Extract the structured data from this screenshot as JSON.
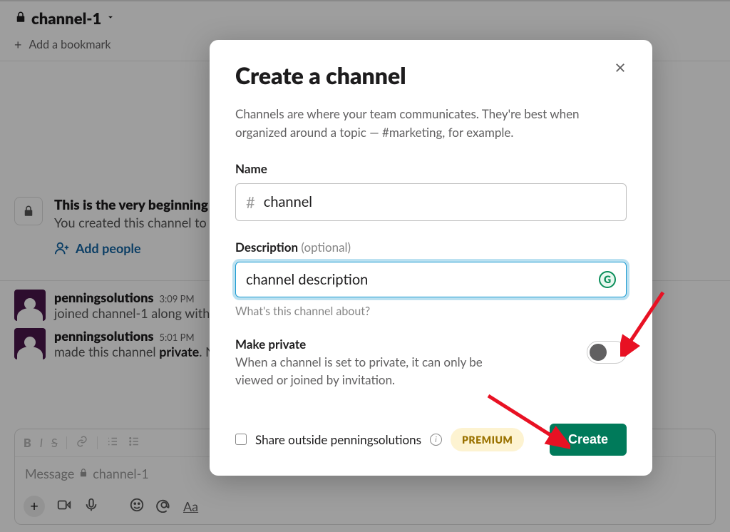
{
  "channel_header": {
    "name": "channel-1"
  },
  "bookmark_bar": {
    "add_label": "Add a bookmark"
  },
  "beginning": {
    "title_prefix": "This is the very beginning o",
    "subtitle_prefix": "You created this channel to",
    "add_people": "Add people"
  },
  "messages": [
    {
      "user": "penningsolutions",
      "time": "3:09 PM",
      "text_prefix": "joined channel-1 along with"
    },
    {
      "user": "penningsolutions",
      "time": "5:01 PM",
      "text_prefix": "made this channel ",
      "text_bold": "private",
      "text_suffix": ". N"
    }
  ],
  "composer": {
    "placeholder_prefix": "Message ",
    "placeholder_channel": "channel-1"
  },
  "modal": {
    "title": "Create a channel",
    "subtext": "Channels are where your team communicates. They're best when organized around a topic — #marketing, for example.",
    "name_label": "Name",
    "name_value": "channel",
    "desc_label": "Description",
    "desc_optional": " (optional)",
    "desc_value": "channel description",
    "desc_helper": "What's this channel about?",
    "private_label": "Make private",
    "private_desc": "When a channel is set to private, it can only be viewed or joined by invitation.",
    "share_label": "Share outside penningsolutions",
    "premium": "PREMIUM",
    "create": "Create"
  }
}
